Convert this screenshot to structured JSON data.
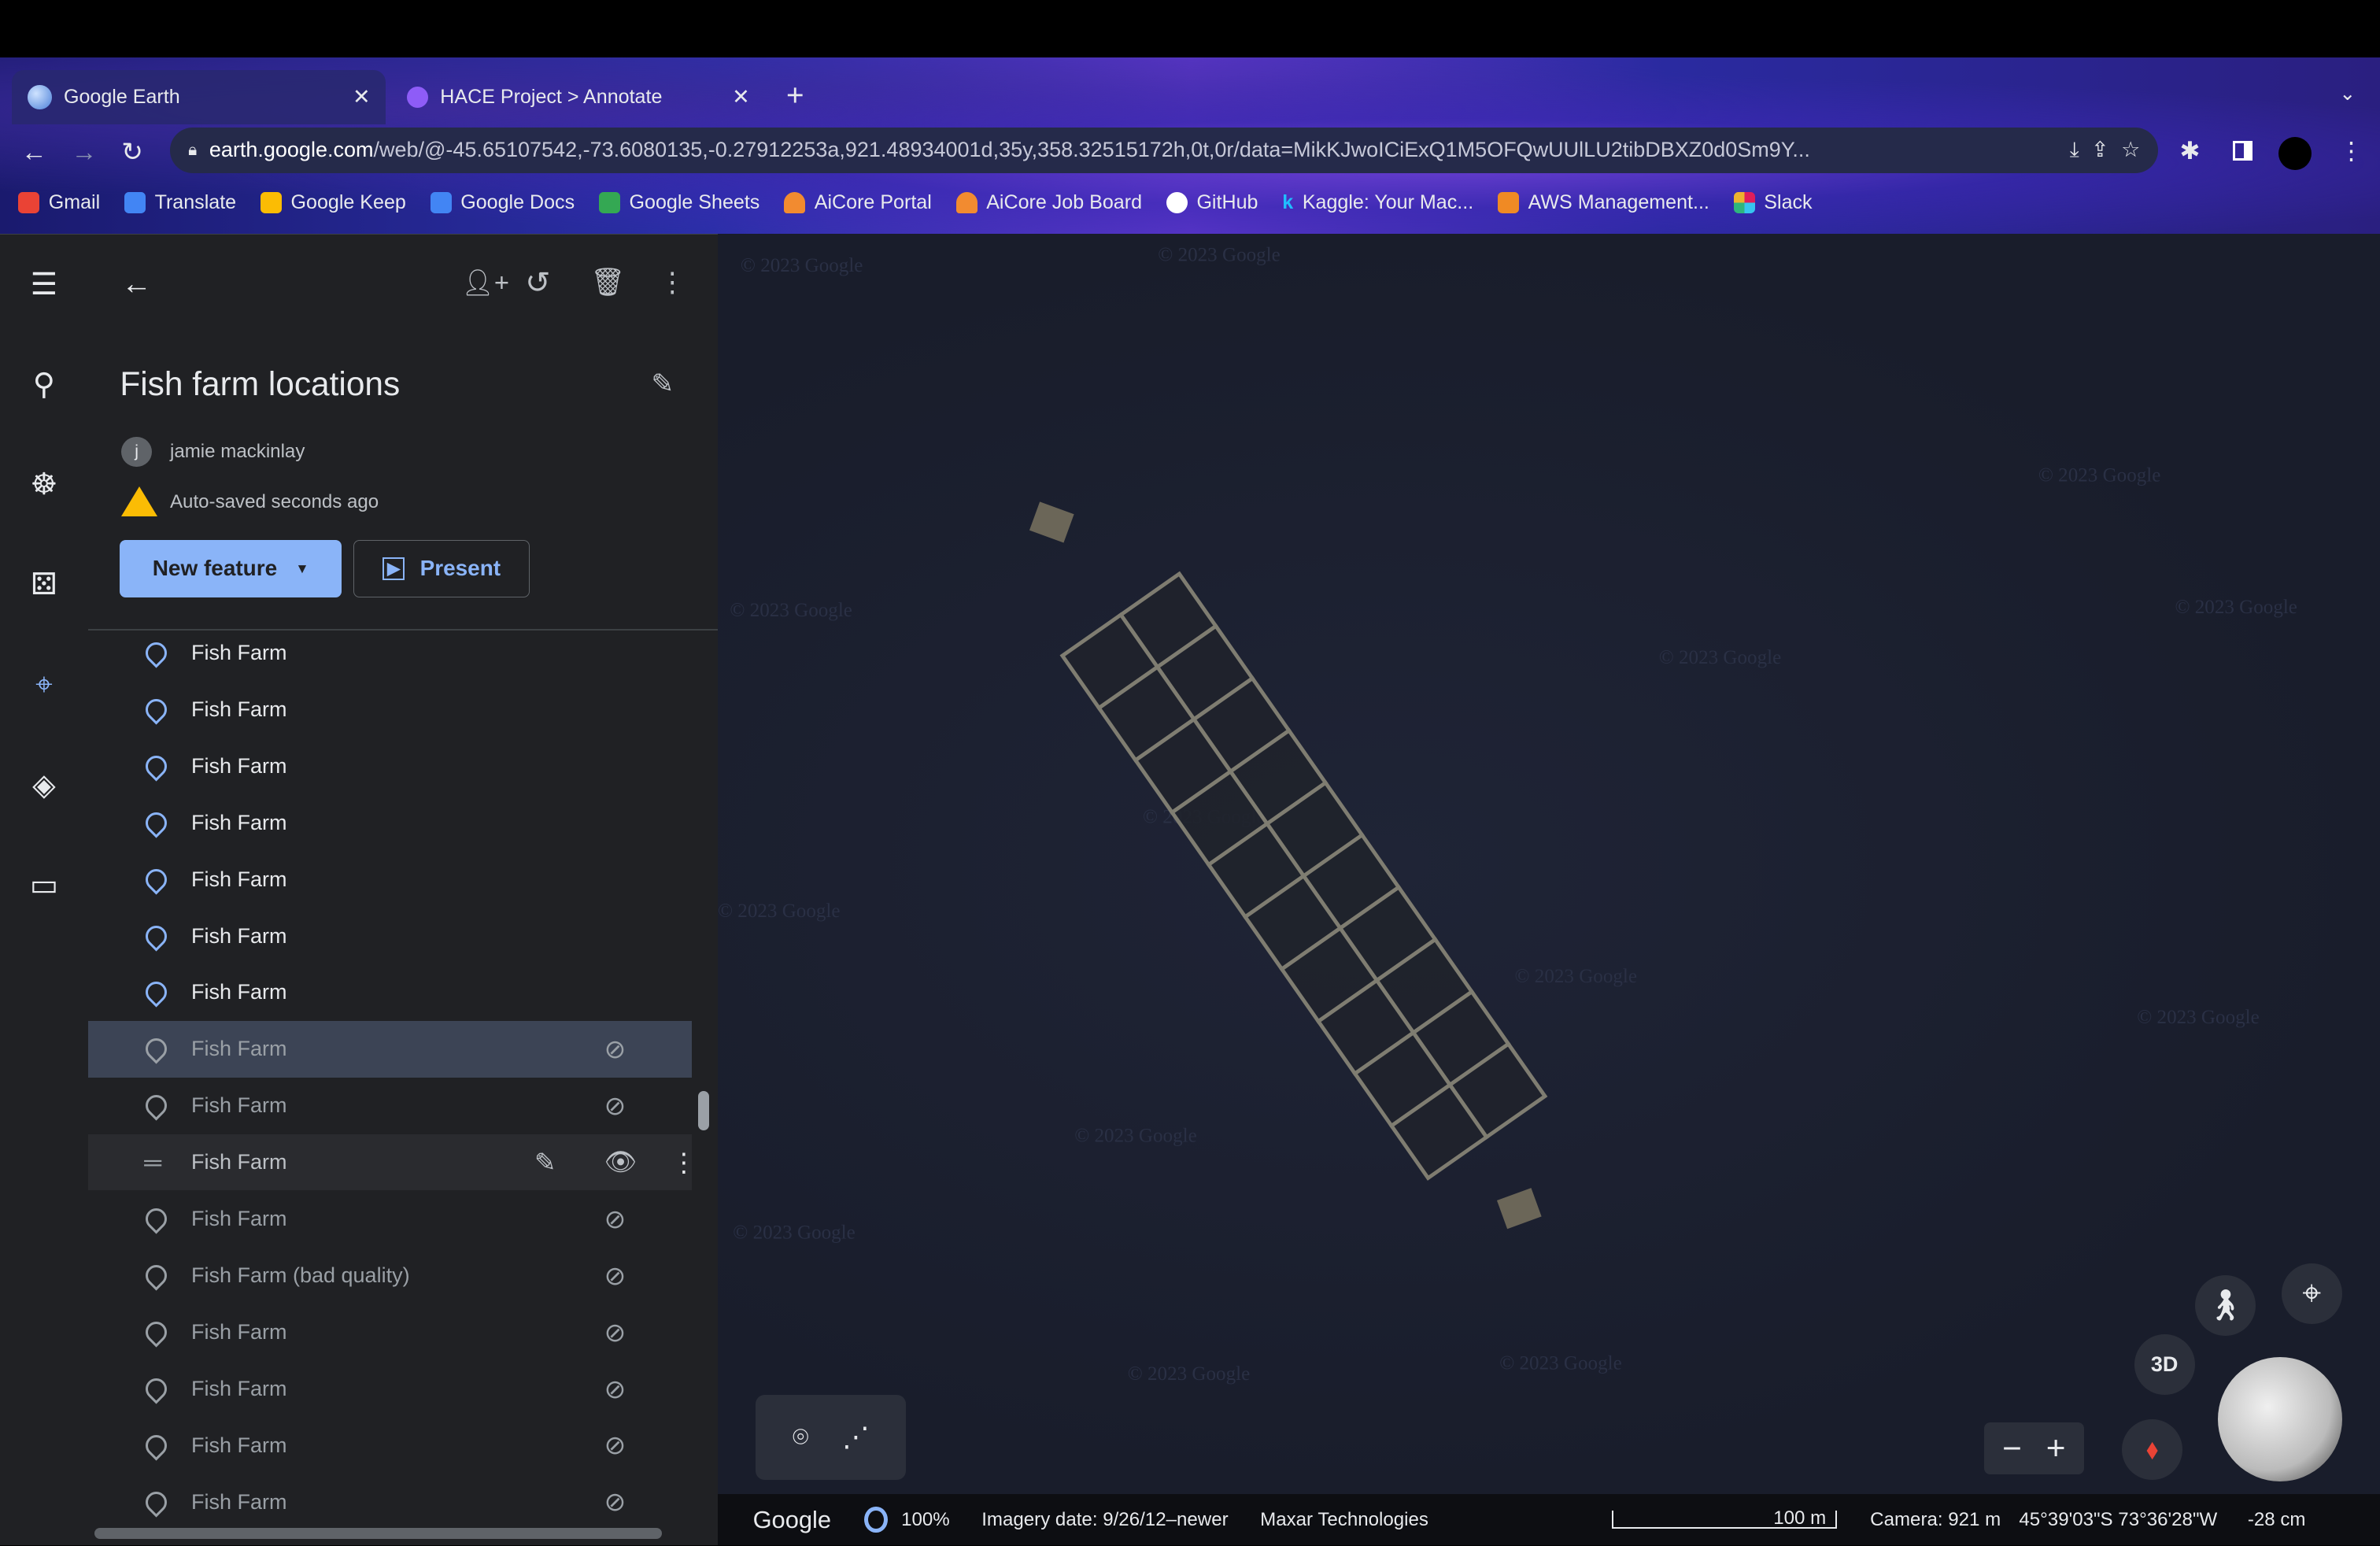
{
  "browser": {
    "tabs": [
      {
        "title": "Google Earth",
        "active": true
      },
      {
        "title": "HACE Project > Annotate",
        "active": false
      }
    ],
    "url_host": "earth.google.com",
    "url_path": "/web/@-45.65107542,-73.6080135,-0.27912253a,921.48934001d,35y,358.32515172h,0t,0r/data=MikKJwoICiExQ1M5OFQwUUlLU2tibDBXZ0d0Sm9Y...",
    "bookmarks": [
      {
        "label": "Gmail",
        "color": "#ea4335"
      },
      {
        "label": "Translate",
        "color": "#4285f4"
      },
      {
        "label": "Google Keep",
        "color": "#fbbc04"
      },
      {
        "label": "Google Docs",
        "color": "#4285f4"
      },
      {
        "label": "Google Sheets",
        "color": "#34a853"
      },
      {
        "label": "AiCore Portal",
        "color": "#f28b30"
      },
      {
        "label": "AiCore Job Board",
        "color": "#f28b30"
      },
      {
        "label": "GitHub",
        "color": "#ffffff"
      },
      {
        "label": "Kaggle: Your Mac...",
        "color": "#20beff"
      },
      {
        "label": "AWS Management...",
        "color": "#f08a24"
      },
      {
        "label": "Slack",
        "color": "#e01e5a"
      }
    ]
  },
  "panel": {
    "title": "Fish farm locations",
    "owner_initial": "j",
    "owner": "jamie mackinlay",
    "saved_status": "Auto-saved seconds ago",
    "new_feature_label": "New feature",
    "present_label": "Present",
    "items": [
      {
        "label": "Fish Farm",
        "hidden": false
      },
      {
        "label": "Fish Farm",
        "hidden": false
      },
      {
        "label": "Fish Farm",
        "hidden": false
      },
      {
        "label": "Fish Farm",
        "hidden": false
      },
      {
        "label": "Fish Farm",
        "hidden": false
      },
      {
        "label": "Fish Farm",
        "hidden": false
      },
      {
        "label": "Fish Farm",
        "hidden": false
      },
      {
        "label": "Fish Farm",
        "hidden": true,
        "selected": true
      },
      {
        "label": "Fish Farm",
        "hidden": true
      },
      {
        "label": "Fish Farm",
        "hidden": false,
        "hovered": true
      },
      {
        "label": "Fish Farm",
        "hidden": true
      },
      {
        "label": "Fish Farm (bad quality)",
        "hidden": true
      },
      {
        "label": "Fish Farm",
        "hidden": true
      },
      {
        "label": "Fish Farm",
        "hidden": true
      },
      {
        "label": "Fish Farm",
        "hidden": true
      },
      {
        "label": "Fish Farm",
        "hidden": true
      }
    ]
  },
  "map": {
    "watermark": "© 2023 Google",
    "btn_3d": "3D"
  },
  "status": {
    "logo": "Google",
    "load": "100%",
    "imagery": "Imagery date: 9/26/12–newer",
    "provider": "Maxar Technologies",
    "scale": "100 m",
    "camera": "Camera: 921 m",
    "coords": "45°39'03\"S 73°36'28\"W",
    "elevation": "-28 cm"
  }
}
